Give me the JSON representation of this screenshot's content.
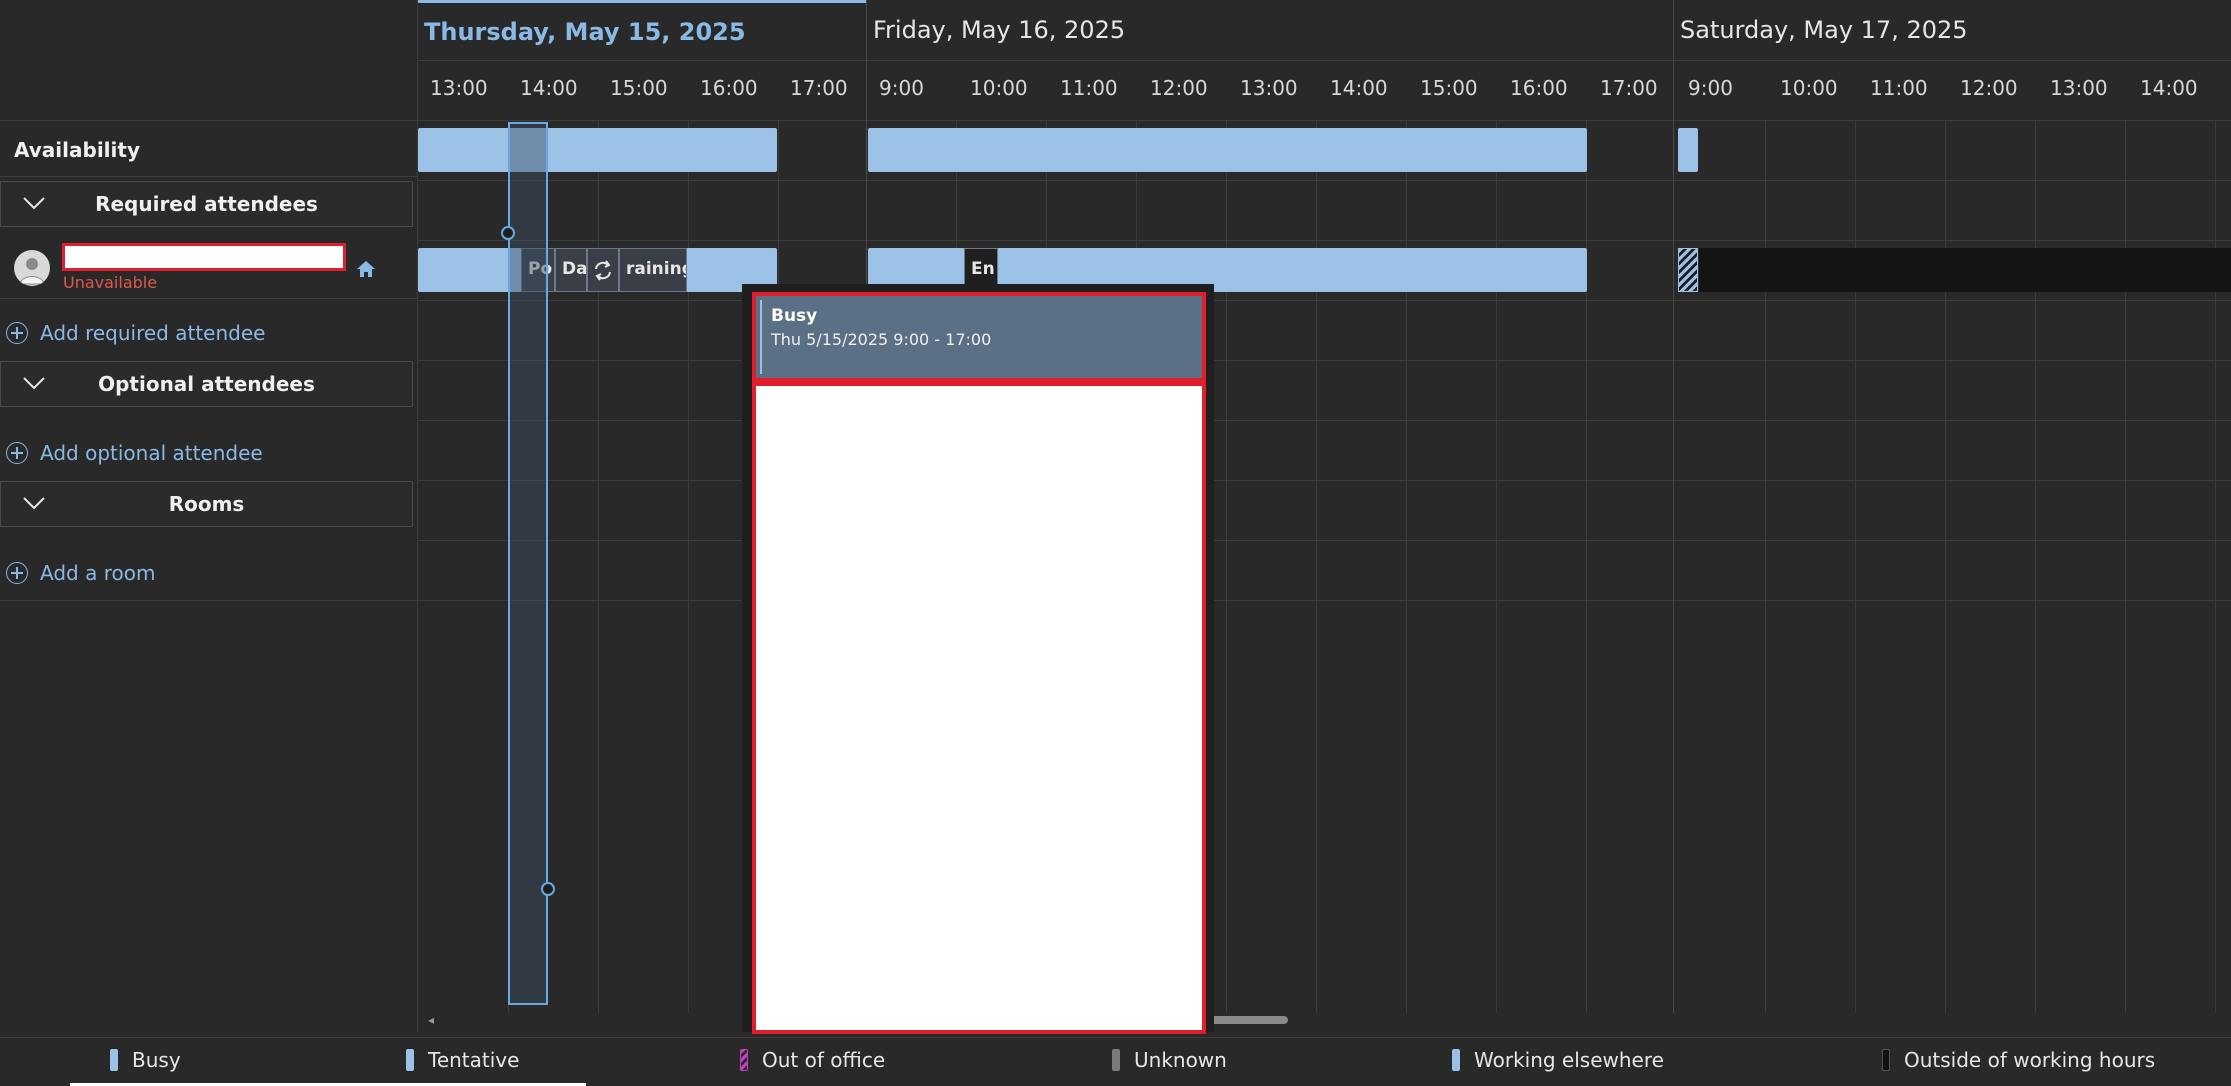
{
  "left": {
    "availability_label": "Availability",
    "sections": {
      "required": "Required attendees",
      "optional": "Optional attendees",
      "rooms": "Rooms"
    },
    "attendee": {
      "name": "",
      "status": "Unavailable"
    },
    "add_required": "Add required attendee",
    "add_optional": "Add optional attendee",
    "add_room": "Add a room"
  },
  "days": [
    {
      "label": "Thursday, May 15, 2025",
      "active": true
    },
    {
      "label": "Friday, May 16, 2025",
      "active": false
    },
    {
      "label": "Saturday, May 17, 2025",
      "active": false
    }
  ],
  "times": {
    "thu": [
      "13:00",
      "14:00",
      "15:00",
      "16:00",
      "17:00"
    ],
    "fri": [
      "9:00",
      "10:00",
      "11:00",
      "12:00",
      "13:00",
      "14:00",
      "15:00",
      "16:00",
      "17:00"
    ],
    "sat": [
      "9:00",
      "10:00",
      "11:00",
      "12:00",
      "13:00",
      "14:00"
    ]
  },
  "appointments": [
    {
      "label": "Po"
    },
    {
      "label": "Da"
    },
    {
      "label": "raining"
    },
    {
      "label": "En"
    }
  ],
  "tooltip": {
    "status": "Busy",
    "time": "Thu 5/15/2025 9:00 - 17:00"
  },
  "legend": [
    {
      "label": "Busy",
      "color": "#9bc2e6"
    },
    {
      "label": "Tentative",
      "color": "#9bc2e6"
    },
    {
      "label": "Out of office",
      "color": "#c040c0"
    },
    {
      "label": "Unknown",
      "color": "#7a7a7a"
    },
    {
      "label": "Working elsewhere",
      "color": "#9bc2e6"
    },
    {
      "label": "Outside of working hours",
      "color": "#111111"
    }
  ]
}
